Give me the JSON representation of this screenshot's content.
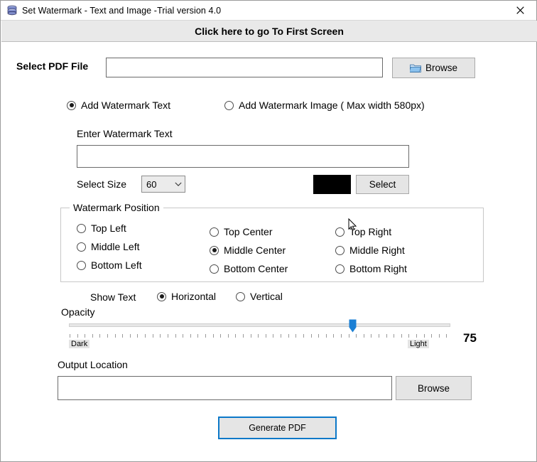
{
  "window": {
    "title": "Set Watermark  - Text and Image -Trial version 4.0",
    "app_icon": "database-stack-icon",
    "close_label": "✕"
  },
  "banner": {
    "text": "Click here to go To First Screen"
  },
  "select_pdf": {
    "label": "Select PDF File",
    "input_value": "",
    "input_placeholder": "",
    "browse_label": "Browse"
  },
  "mode": {
    "options": [
      {
        "label": "Add Watermark Text",
        "checked": true
      },
      {
        "label": "Add Watermark Image ( Max width 580px)",
        "checked": false
      }
    ]
  },
  "watermark_text": {
    "label": "Enter Watermark Text",
    "input_value": "",
    "input_placeholder": ""
  },
  "size": {
    "label": "Select Size",
    "value": "60"
  },
  "color": {
    "swatch_hex": "#000000",
    "select_label": "Select"
  },
  "position": {
    "group_title": "Watermark Position",
    "col1": [
      {
        "label": "Top Left",
        "checked": false
      },
      {
        "label": "Middle Left",
        "checked": false
      },
      {
        "label": "Bottom Left",
        "checked": false
      }
    ],
    "col2": [
      {
        "label": "Top Center",
        "checked": false
      },
      {
        "label": "Middle Center",
        "checked": true
      },
      {
        "label": "Bottom Center",
        "checked": false
      }
    ],
    "col3": [
      {
        "label": "Top Right",
        "checked": false
      },
      {
        "label": "Middle Right",
        "checked": false
      },
      {
        "label": "Bottom Right",
        "checked": false
      }
    ]
  },
  "orientation": {
    "label": "Show Text",
    "options": [
      {
        "label": "Horizontal",
        "checked": true
      },
      {
        "label": "Vertical",
        "checked": false
      }
    ]
  },
  "opacity": {
    "label": "Opacity",
    "min_label": "Dark",
    "max_label": "Light",
    "value": "75",
    "min": 0,
    "max": 100,
    "accent_hex": "#1a7fd4"
  },
  "output": {
    "label": "Output Location",
    "input_value": "",
    "input_placeholder": "",
    "browse_label": "Browse"
  },
  "generate": {
    "label": "Generate PDF",
    "border_hex": "#0b78c8"
  }
}
